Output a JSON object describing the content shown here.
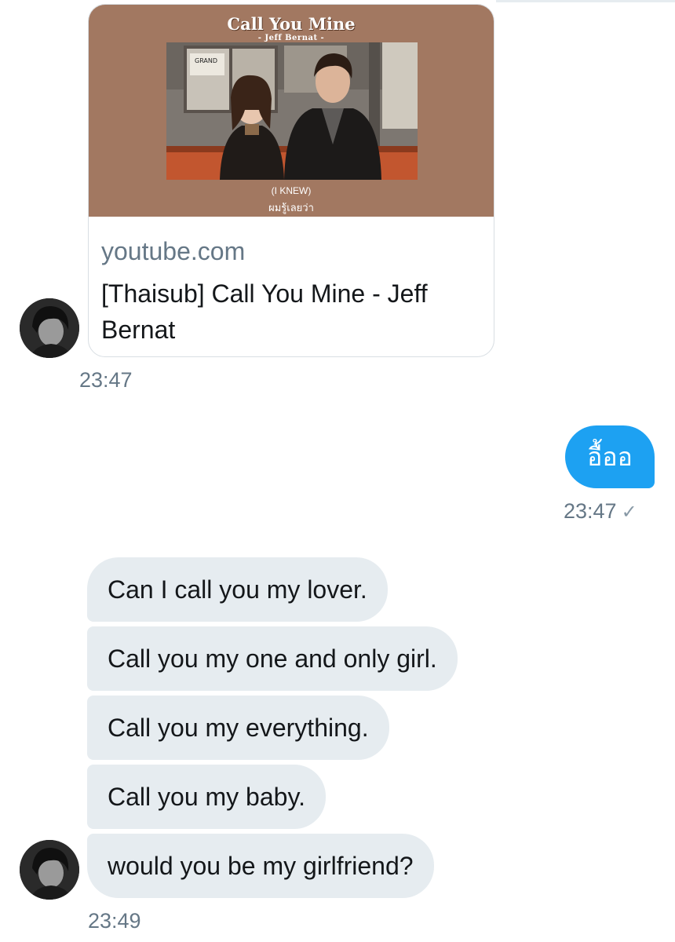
{
  "link_card": {
    "thumbnail_title": "Call You Mine",
    "thumbnail_subtitle": "- Jeff Bernat -",
    "thumbnail_caption_en": "(I KNEW)",
    "thumbnail_caption_th": "ผมรู้เลยว่า",
    "poster_text": "GRAND",
    "domain": "youtube.com",
    "title": "[Thaisub] Call You Mine - Jeff Bernat",
    "thumbnail_color": "#a27861"
  },
  "messages": [
    {
      "id": "link-message",
      "direction": "incoming",
      "time": "23:47"
    },
    {
      "id": "reply",
      "direction": "outgoing",
      "text": "อื้ออ",
      "time": "23:47",
      "status_icon": "check-icon"
    },
    {
      "id": "group",
      "direction": "incoming",
      "lines": [
        "Can I call you my lover.",
        "Call you my one and only girl.",
        "Call you my everything.",
        "Call you my baby.",
        "would you be my girlfriend?"
      ],
      "time": "23:49"
    }
  ],
  "colors": {
    "outgoing_bubble": "#1da1f2",
    "incoming_bubble": "#e6ecf0",
    "timestamp": "#657786"
  }
}
